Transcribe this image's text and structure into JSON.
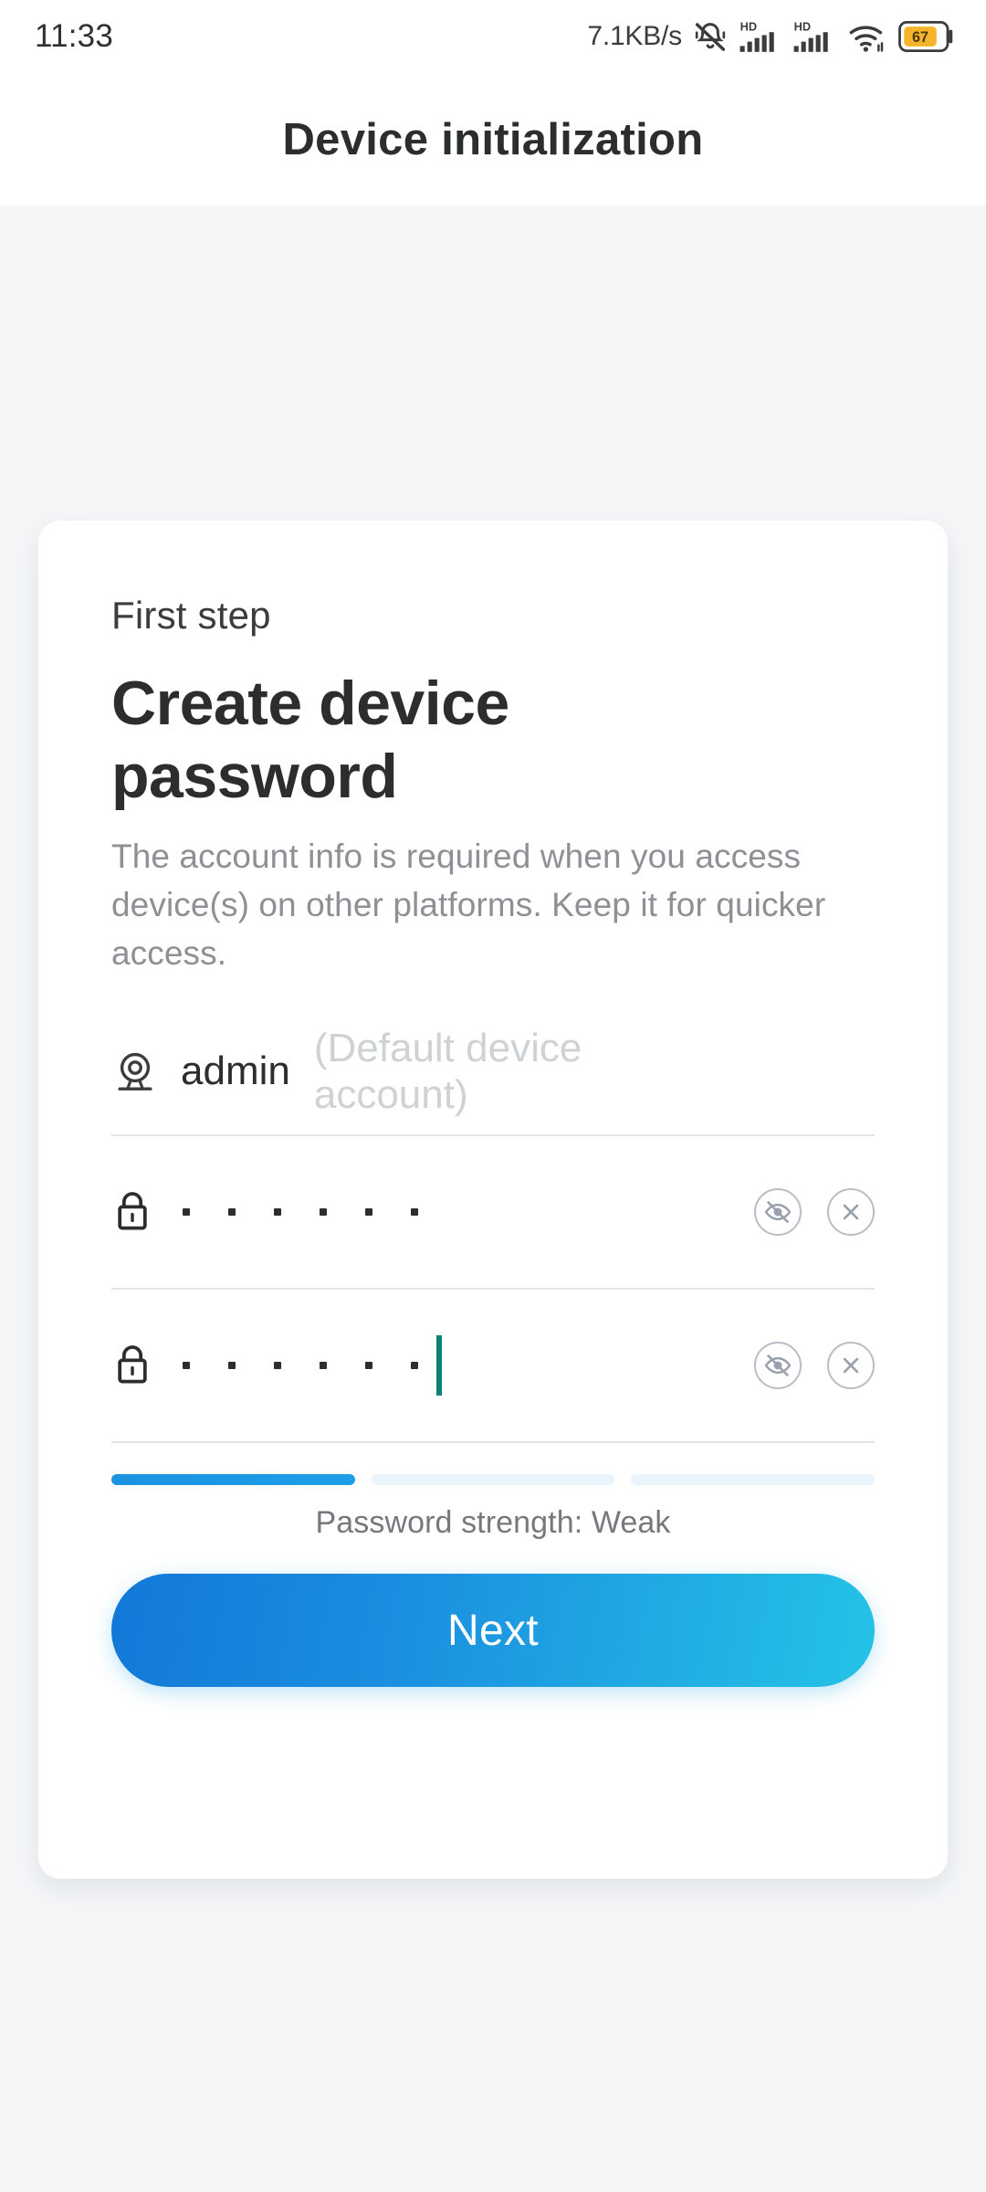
{
  "status_bar": {
    "time": "11:33",
    "network_speed": "7.1KB/s",
    "icons": [
      {
        "name": "mute-bell-icon",
        "label": "silent"
      },
      {
        "name": "signal-hd-1-icon",
        "label": "HD"
      },
      {
        "name": "signal-hd-2-icon",
        "label": "HD"
      },
      {
        "name": "wifi-icon",
        "label": "wifi"
      },
      {
        "name": "battery-icon",
        "label": "67"
      }
    ],
    "battery_percent": "67",
    "battery_color": "#F6B42A"
  },
  "header": {
    "title": "Device initialization"
  },
  "card": {
    "step_label": "First step",
    "title": "Create device password",
    "description": "The account info is required when you access device(s) on other platforms. Keep it for quicker access.",
    "username_field": {
      "icon": "camera-icon",
      "value": "admin",
      "hint": "(Default device account)"
    },
    "password_field": {
      "icon": "lock-icon",
      "masked_value": "••••••",
      "dot_count": 6,
      "toggle_icon": "eye-off-icon",
      "clear_icon": "close-circle-icon"
    },
    "confirm_password_field": {
      "icon": "lock-icon",
      "masked_value": "••••••",
      "dot_count": 6,
      "toggle_icon": "eye-off-icon",
      "clear_icon": "close-circle-icon",
      "caret_visible": true,
      "caret_color": "#0D8378"
    },
    "strength": {
      "label": "Password strength: Weak",
      "level": 1,
      "total_segments": 3,
      "active_color": "#1A93E0",
      "inactive_color": "#EAF4FB"
    },
    "next_button": "Next"
  },
  "colors": {
    "background": "#F4F6F8",
    "card": "#FFFFFF",
    "accent_start": "#1278D8",
    "accent_end": "#24C3E6",
    "text_primary": "#2B2D2F",
    "text_muted": "#8D9094"
  }
}
